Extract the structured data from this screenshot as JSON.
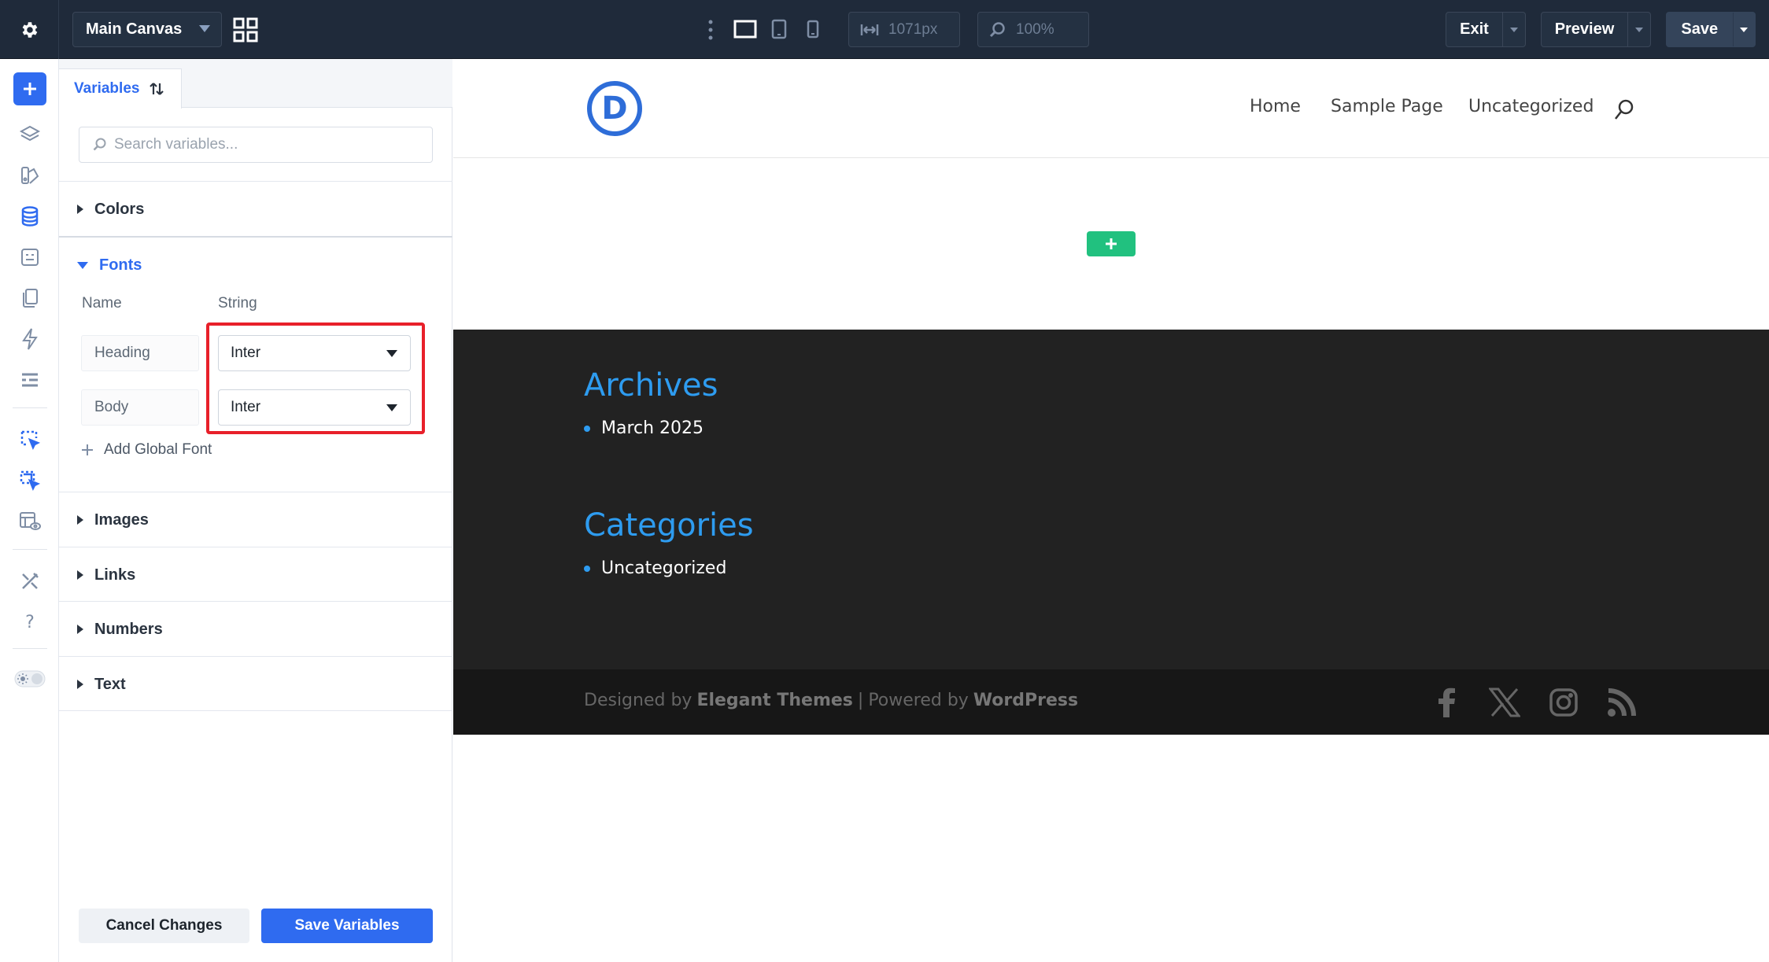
{
  "topbar": {
    "canvas_select": "Main Canvas",
    "width_value": "1071px",
    "zoom_value": "100%",
    "exit_label": "Exit",
    "preview_label": "Preview",
    "save_label": "Save"
  },
  "panel": {
    "tab_label": "Variables",
    "search_placeholder": "Search variables...",
    "sections": {
      "colors": "Colors",
      "fonts": "Fonts",
      "images": "Images",
      "links": "Links",
      "numbers": "Numbers",
      "text": "Text"
    },
    "fonts": {
      "col_name": "Name",
      "col_string": "String",
      "rows": [
        {
          "name": "Heading",
          "value": "Inter"
        },
        {
          "name": "Body",
          "value": "Inter"
        }
      ],
      "add_label": "Add Global Font"
    },
    "cancel_label": "Cancel Changes",
    "save_label": "Save Variables"
  },
  "site": {
    "logo_letter": "D",
    "nav": [
      "Home",
      "Sample Page",
      "Uncategorized"
    ],
    "widgets": [
      {
        "title": "Archives",
        "items": [
          "March 2025"
        ]
      },
      {
        "title": "Categories",
        "items": [
          "Uncategorized"
        ]
      }
    ],
    "credits": {
      "prefix": "Designed by",
      "brand": "Elegant Themes",
      "sep": "|",
      "powered": "Powered by",
      "platform": "WordPress"
    },
    "social_icons": [
      "facebook-icon",
      "x-icon",
      "instagram-icon",
      "rss-icon"
    ]
  },
  "colors": {
    "accent": "#2f6bf0",
    "topbar_bg": "#1f2a3a",
    "highlight": "#e8202a",
    "widget_title": "#2e9cf0",
    "add_section": "#21c17f"
  }
}
